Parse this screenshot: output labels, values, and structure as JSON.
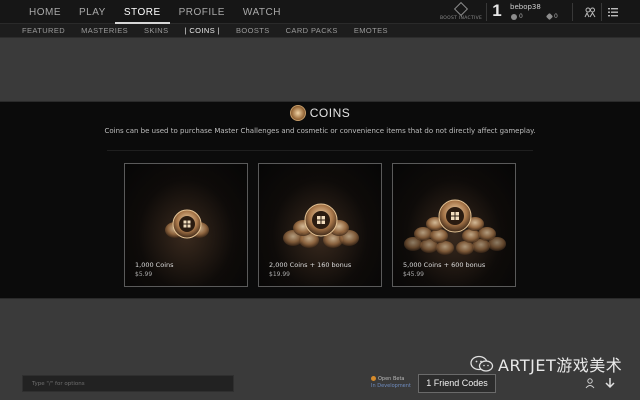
{
  "top_nav": {
    "items": [
      {
        "label": "HOME"
      },
      {
        "label": "PLAY"
      },
      {
        "label": "STORE",
        "active": true
      },
      {
        "label": "PROFILE"
      },
      {
        "label": "WATCH"
      }
    ]
  },
  "boost": {
    "label": "BOOST INACTIVE",
    "icon": "boost-icon"
  },
  "user": {
    "level": "1",
    "name": "bebop38",
    "currency_a": "0",
    "currency_b": "0"
  },
  "icons": {
    "social": "friends-icon",
    "menu": "menu-list-icon"
  },
  "sub_nav": {
    "items": [
      {
        "label": "FEATURED"
      },
      {
        "label": "MASTERIES"
      },
      {
        "label": "SKINS"
      },
      {
        "label": "| COINS |",
        "active": true
      },
      {
        "label": "BOOSTS"
      },
      {
        "label": "CARD PACKS"
      },
      {
        "label": "EMOTES"
      }
    ]
  },
  "store": {
    "title": "COINS",
    "description": "Coins can be used to purchase Master Challenges and cosmetic or convenience items that do not directly affect gameplay.",
    "products": [
      {
        "name": "1,000 Coins",
        "price": "$5.99"
      },
      {
        "name": "2,000 Coins + 160 bonus",
        "price": "$19.99"
      },
      {
        "name": "5,000 Coins + 600 bonus",
        "price": "$45.99"
      }
    ]
  },
  "chat": {
    "placeholder": "Type \"/\" for options"
  },
  "beta_notice": {
    "line1": "Open Beta",
    "line2": "In Development"
  },
  "friend_codes_label": "1 Friend Codes",
  "watermark": {
    "text": "ARTJET游戏美术"
  },
  "colors": {
    "accent_gold": "#c59b67",
    "bg_band": "#0b0b0b",
    "bg_page": "#3a3a3a"
  }
}
